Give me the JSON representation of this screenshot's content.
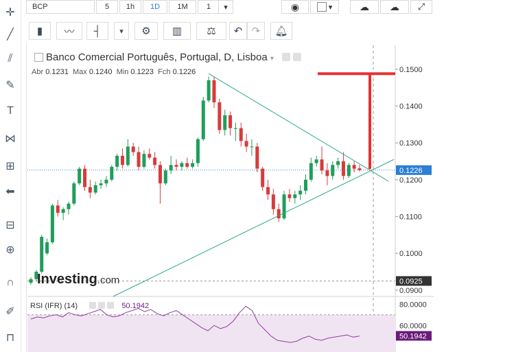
{
  "toolbar": {
    "symbol": "BCP",
    "intervals": [
      "5",
      "1h",
      "1D",
      "1M",
      "1"
    ],
    "active_interval": "1D"
  },
  "chart_title": "Banco Comercial Português, Portugal, D, Lisboa",
  "ohlc": {
    "open_label": "Abr",
    "open": "0.1231",
    "max_label": "Max",
    "max": "0.1240",
    "min_label": "Min",
    "min": "0.1223",
    "close_label": "Fch",
    "close": "0.1226"
  },
  "rsi": {
    "label": "RSI (IFR) (14)",
    "value": "50.1942"
  },
  "brand": {
    "name": "Investing",
    "suffix": ".com"
  },
  "chart_data": {
    "type": "candlestick",
    "ylim": [
      0.0883,
      0.1565
    ],
    "yticks": [
      "0.1500",
      "0.1400",
      "0.1300",
      "0.1200",
      "0.1100",
      "0.1000",
      "0.0900"
    ],
    "price_markers": [
      {
        "label": "0.1226",
        "value": 0.1226,
        "color": "#2b7fd4"
      },
      {
        "label": "0.0925",
        "value": 0.0925,
        "color": "#333333"
      }
    ],
    "rsi_ticks": [
      "80.0000",
      "60.0000"
    ],
    "rsi_marker": {
      "label": "50.1942",
      "value": 50.1942,
      "color": "#6a1b7a"
    },
    "rsi_ylim": [
      35,
      86
    ],
    "rsi_band": [
      30,
      70
    ],
    "candles": [
      [
        0.092,
        0.0935,
        0.0915,
        0.093
      ],
      [
        0.093,
        0.0955,
        0.0925,
        0.095
      ],
      [
        0.095,
        0.105,
        0.0945,
        0.1045
      ],
      [
        0.1,
        0.104,
        0.0995,
        0.103
      ],
      [
        0.103,
        0.1135,
        0.1025,
        0.113
      ],
      [
        0.113,
        0.1145,
        0.11,
        0.111
      ],
      [
        0.111,
        0.1125,
        0.109,
        0.112
      ],
      [
        0.112,
        0.114,
        0.1105,
        0.1135
      ],
      [
        0.1135,
        0.1195,
        0.113,
        0.119
      ],
      [
        0.119,
        0.1235,
        0.1185,
        0.123
      ],
      [
        0.123,
        0.124,
        0.117,
        0.118
      ],
      [
        0.118,
        0.12,
        0.115,
        0.1165
      ],
      [
        0.1165,
        0.1195,
        0.116,
        0.1185
      ],
      [
        0.1185,
        0.12,
        0.1175,
        0.119
      ],
      [
        0.119,
        0.121,
        0.118,
        0.12
      ],
      [
        0.12,
        0.124,
        0.1195,
        0.1235
      ],
      [
        0.1235,
        0.127,
        0.1225,
        0.1265
      ],
      [
        0.1265,
        0.1285,
        0.123,
        0.124
      ],
      [
        0.124,
        0.131,
        0.1235,
        0.129
      ],
      [
        0.129,
        0.13,
        0.1265,
        0.1275
      ],
      [
        0.1275,
        0.129,
        0.1225,
        0.1235
      ],
      [
        0.1235,
        0.128,
        0.123,
        0.127
      ],
      [
        0.127,
        0.1285,
        0.1255,
        0.126
      ],
      [
        0.126,
        0.1275,
        0.123,
        0.124
      ],
      [
        0.124,
        0.125,
        0.1135,
        0.119
      ],
      [
        0.119,
        0.123,
        0.1185,
        0.1225
      ],
      [
        0.1225,
        0.1265,
        0.1215,
        0.124
      ],
      [
        0.124,
        0.1255,
        0.1225,
        0.1235
      ],
      [
        0.1235,
        0.125,
        0.1225,
        0.1245
      ],
      [
        0.1245,
        0.126,
        0.123,
        0.1235
      ],
      [
        0.1235,
        0.1255,
        0.123,
        0.1245
      ],
      [
        0.1245,
        0.1315,
        0.1235,
        0.131
      ],
      [
        0.131,
        0.1425,
        0.1305,
        0.1415
      ],
      [
        0.1415,
        0.148,
        0.141,
        0.147
      ],
      [
        0.147,
        0.148,
        0.1395,
        0.141
      ],
      [
        0.141,
        0.142,
        0.1325,
        0.1335
      ],
      [
        0.1335,
        0.139,
        0.132,
        0.1375
      ],
      [
        0.1375,
        0.1385,
        0.132,
        0.134
      ],
      [
        0.134,
        0.1355,
        0.1305,
        0.134
      ],
      [
        0.134,
        0.1355,
        0.129,
        0.1305
      ],
      [
        0.1305,
        0.1325,
        0.1275,
        0.129
      ],
      [
        0.129,
        0.131,
        0.1265,
        0.129
      ],
      [
        0.129,
        0.13,
        0.122,
        0.123
      ],
      [
        0.123,
        0.1235,
        0.117,
        0.118
      ],
      [
        0.118,
        0.12,
        0.1145,
        0.116
      ],
      [
        0.116,
        0.1175,
        0.1105,
        0.112
      ],
      [
        0.112,
        0.1135,
        0.1085,
        0.1095
      ],
      [
        0.1095,
        0.117,
        0.109,
        0.116
      ],
      [
        0.116,
        0.1175,
        0.114,
        0.115
      ],
      [
        0.115,
        0.117,
        0.1135,
        0.116
      ],
      [
        0.116,
        0.1185,
        0.1145,
        0.117
      ],
      [
        0.117,
        0.1215,
        0.116,
        0.12
      ],
      [
        0.12,
        0.126,
        0.1195,
        0.1245
      ],
      [
        0.1245,
        0.1265,
        0.1235,
        0.1255
      ],
      [
        0.1255,
        0.129,
        0.1215,
        0.1225
      ],
      [
        0.1225,
        0.1245,
        0.1185,
        0.121
      ],
      [
        0.121,
        0.125,
        0.12,
        0.124
      ],
      [
        0.124,
        0.126,
        0.123,
        0.125
      ],
      [
        0.125,
        0.1275,
        0.12,
        0.121
      ],
      [
        0.121,
        0.1245,
        0.1205,
        0.124
      ],
      [
        0.124,
        0.125,
        0.122,
        0.123
      ],
      [
        0.1231,
        0.124,
        0.1223,
        0.1226
      ]
    ],
    "rsi_values": [
      66,
      68,
      67,
      69,
      70,
      68,
      72,
      70,
      69,
      71,
      73,
      75,
      70,
      68,
      69,
      72,
      74,
      76,
      73,
      75,
      71,
      69,
      72,
      74,
      70,
      66,
      62,
      58,
      55,
      60,
      57,
      59,
      64,
      72,
      78,
      74,
      62,
      56,
      50,
      46,
      45,
      44,
      45,
      48,
      50,
      47,
      46,
      48,
      49,
      50,
      51,
      49,
      50
    ]
  }
}
